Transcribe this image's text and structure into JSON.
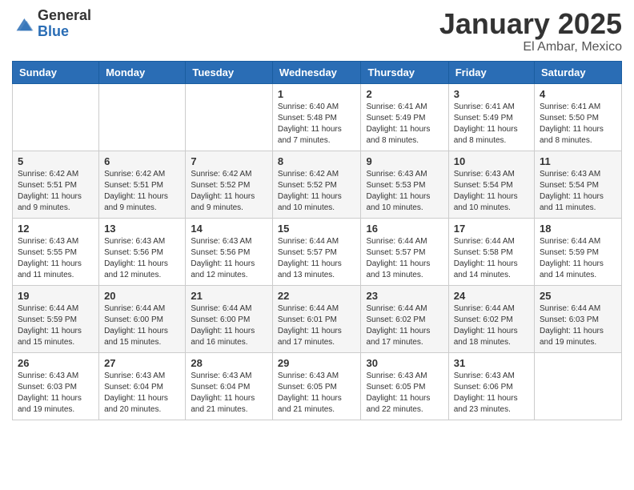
{
  "logo": {
    "general": "General",
    "blue": "Blue"
  },
  "title": "January 2025",
  "location": "El Ambar, Mexico",
  "days_of_week": [
    "Sunday",
    "Monday",
    "Tuesday",
    "Wednesday",
    "Thursday",
    "Friday",
    "Saturday"
  ],
  "weeks": [
    [
      {
        "day": "",
        "sunrise": "",
        "sunset": "",
        "daylight": ""
      },
      {
        "day": "",
        "sunrise": "",
        "sunset": "",
        "daylight": ""
      },
      {
        "day": "",
        "sunrise": "",
        "sunset": "",
        "daylight": ""
      },
      {
        "day": "1",
        "sunrise": "Sunrise: 6:40 AM",
        "sunset": "Sunset: 5:48 PM",
        "daylight": "Daylight: 11 hours and 7 minutes."
      },
      {
        "day": "2",
        "sunrise": "Sunrise: 6:41 AM",
        "sunset": "Sunset: 5:49 PM",
        "daylight": "Daylight: 11 hours and 8 minutes."
      },
      {
        "day": "3",
        "sunrise": "Sunrise: 6:41 AM",
        "sunset": "Sunset: 5:49 PM",
        "daylight": "Daylight: 11 hours and 8 minutes."
      },
      {
        "day": "4",
        "sunrise": "Sunrise: 6:41 AM",
        "sunset": "Sunset: 5:50 PM",
        "daylight": "Daylight: 11 hours and 8 minutes."
      }
    ],
    [
      {
        "day": "5",
        "sunrise": "Sunrise: 6:42 AM",
        "sunset": "Sunset: 5:51 PM",
        "daylight": "Daylight: 11 hours and 9 minutes."
      },
      {
        "day": "6",
        "sunrise": "Sunrise: 6:42 AM",
        "sunset": "Sunset: 5:51 PM",
        "daylight": "Daylight: 11 hours and 9 minutes."
      },
      {
        "day": "7",
        "sunrise": "Sunrise: 6:42 AM",
        "sunset": "Sunset: 5:52 PM",
        "daylight": "Daylight: 11 hours and 9 minutes."
      },
      {
        "day": "8",
        "sunrise": "Sunrise: 6:42 AM",
        "sunset": "Sunset: 5:52 PM",
        "daylight": "Daylight: 11 hours and 10 minutes."
      },
      {
        "day": "9",
        "sunrise": "Sunrise: 6:43 AM",
        "sunset": "Sunset: 5:53 PM",
        "daylight": "Daylight: 11 hours and 10 minutes."
      },
      {
        "day": "10",
        "sunrise": "Sunrise: 6:43 AM",
        "sunset": "Sunset: 5:54 PM",
        "daylight": "Daylight: 11 hours and 10 minutes."
      },
      {
        "day": "11",
        "sunrise": "Sunrise: 6:43 AM",
        "sunset": "Sunset: 5:54 PM",
        "daylight": "Daylight: 11 hours and 11 minutes."
      }
    ],
    [
      {
        "day": "12",
        "sunrise": "Sunrise: 6:43 AM",
        "sunset": "Sunset: 5:55 PM",
        "daylight": "Daylight: 11 hours and 11 minutes."
      },
      {
        "day": "13",
        "sunrise": "Sunrise: 6:43 AM",
        "sunset": "Sunset: 5:56 PM",
        "daylight": "Daylight: 11 hours and 12 minutes."
      },
      {
        "day": "14",
        "sunrise": "Sunrise: 6:43 AM",
        "sunset": "Sunset: 5:56 PM",
        "daylight": "Daylight: 11 hours and 12 minutes."
      },
      {
        "day": "15",
        "sunrise": "Sunrise: 6:44 AM",
        "sunset": "Sunset: 5:57 PM",
        "daylight": "Daylight: 11 hours and 13 minutes."
      },
      {
        "day": "16",
        "sunrise": "Sunrise: 6:44 AM",
        "sunset": "Sunset: 5:57 PM",
        "daylight": "Daylight: 11 hours and 13 minutes."
      },
      {
        "day": "17",
        "sunrise": "Sunrise: 6:44 AM",
        "sunset": "Sunset: 5:58 PM",
        "daylight": "Daylight: 11 hours and 14 minutes."
      },
      {
        "day": "18",
        "sunrise": "Sunrise: 6:44 AM",
        "sunset": "Sunset: 5:59 PM",
        "daylight": "Daylight: 11 hours and 14 minutes."
      }
    ],
    [
      {
        "day": "19",
        "sunrise": "Sunrise: 6:44 AM",
        "sunset": "Sunset: 5:59 PM",
        "daylight": "Daylight: 11 hours and 15 minutes."
      },
      {
        "day": "20",
        "sunrise": "Sunrise: 6:44 AM",
        "sunset": "Sunset: 6:00 PM",
        "daylight": "Daylight: 11 hours and 15 minutes."
      },
      {
        "day": "21",
        "sunrise": "Sunrise: 6:44 AM",
        "sunset": "Sunset: 6:00 PM",
        "daylight": "Daylight: 11 hours and 16 minutes."
      },
      {
        "day": "22",
        "sunrise": "Sunrise: 6:44 AM",
        "sunset": "Sunset: 6:01 PM",
        "daylight": "Daylight: 11 hours and 17 minutes."
      },
      {
        "day": "23",
        "sunrise": "Sunrise: 6:44 AM",
        "sunset": "Sunset: 6:02 PM",
        "daylight": "Daylight: 11 hours and 17 minutes."
      },
      {
        "day": "24",
        "sunrise": "Sunrise: 6:44 AM",
        "sunset": "Sunset: 6:02 PM",
        "daylight": "Daylight: 11 hours and 18 minutes."
      },
      {
        "day": "25",
        "sunrise": "Sunrise: 6:44 AM",
        "sunset": "Sunset: 6:03 PM",
        "daylight": "Daylight: 11 hours and 19 minutes."
      }
    ],
    [
      {
        "day": "26",
        "sunrise": "Sunrise: 6:43 AM",
        "sunset": "Sunset: 6:03 PM",
        "daylight": "Daylight: 11 hours and 19 minutes."
      },
      {
        "day": "27",
        "sunrise": "Sunrise: 6:43 AM",
        "sunset": "Sunset: 6:04 PM",
        "daylight": "Daylight: 11 hours and 20 minutes."
      },
      {
        "day": "28",
        "sunrise": "Sunrise: 6:43 AM",
        "sunset": "Sunset: 6:04 PM",
        "daylight": "Daylight: 11 hours and 21 minutes."
      },
      {
        "day": "29",
        "sunrise": "Sunrise: 6:43 AM",
        "sunset": "Sunset: 6:05 PM",
        "daylight": "Daylight: 11 hours and 21 minutes."
      },
      {
        "day": "30",
        "sunrise": "Sunrise: 6:43 AM",
        "sunset": "Sunset: 6:05 PM",
        "daylight": "Daylight: 11 hours and 22 minutes."
      },
      {
        "day": "31",
        "sunrise": "Sunrise: 6:43 AM",
        "sunset": "Sunset: 6:06 PM",
        "daylight": "Daylight: 11 hours and 23 minutes."
      },
      {
        "day": "",
        "sunrise": "",
        "sunset": "",
        "daylight": ""
      }
    ]
  ]
}
